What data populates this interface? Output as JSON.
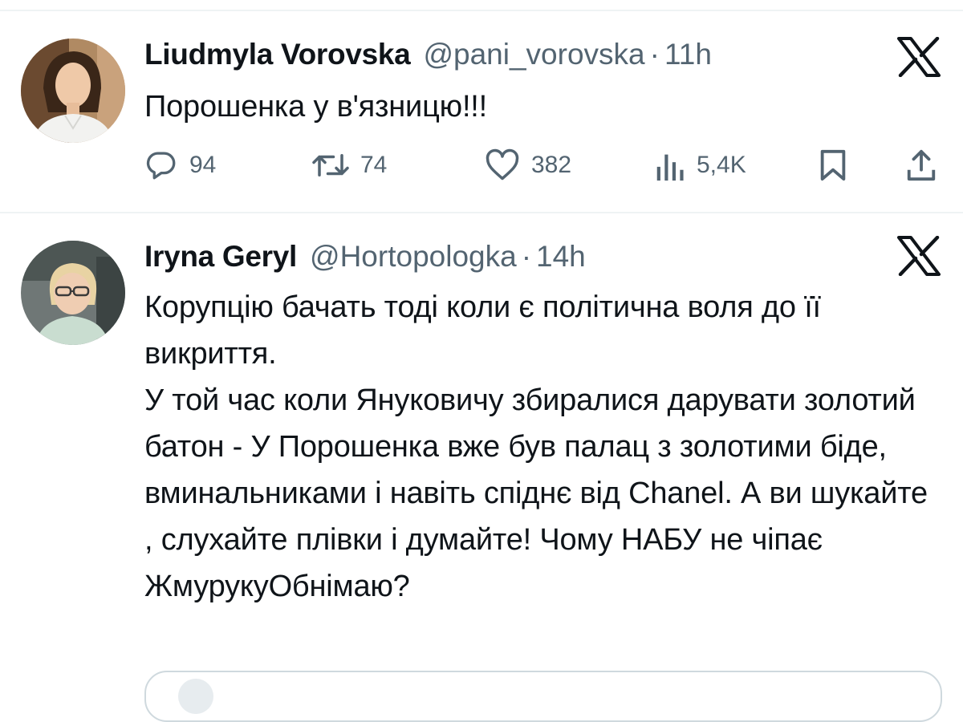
{
  "colors": {
    "text_primary": "#0f1419",
    "text_secondary": "#536471",
    "divider": "#eff3f4"
  },
  "tweets": [
    {
      "author": {
        "name": "Liudmyla Vorovska",
        "handle": "@pani_vorovska",
        "time": "11h",
        "avatar_icon": "profile-photo-woman-dark-hair"
      },
      "text": "Порошенка у в'язницю!!!",
      "actions": {
        "replies": "94",
        "retweets": "74",
        "likes": "382",
        "views": "5,4K"
      },
      "platform_icon": "x-logo-icon"
    },
    {
      "author": {
        "name": "Iryna Geryl",
        "handle": "@Hortopologka",
        "time": "14h",
        "avatar_icon": "profile-photo-woman-glasses"
      },
      "text_lines": [
        "Корупцію бачать тоді коли є політична воля до її викриття.",
        "У той час коли Януковичу збиралися дарувати золотий батон - У Порошенка вже був палац з золотими біде, вминальниками і навіть спіднє від Chanel. А ви шукайте , слухайте плівки і думайте! Чому НАБУ не чіпає ЖмурукуОбнімаю?"
      ],
      "platform_icon": "x-logo-icon"
    }
  ]
}
